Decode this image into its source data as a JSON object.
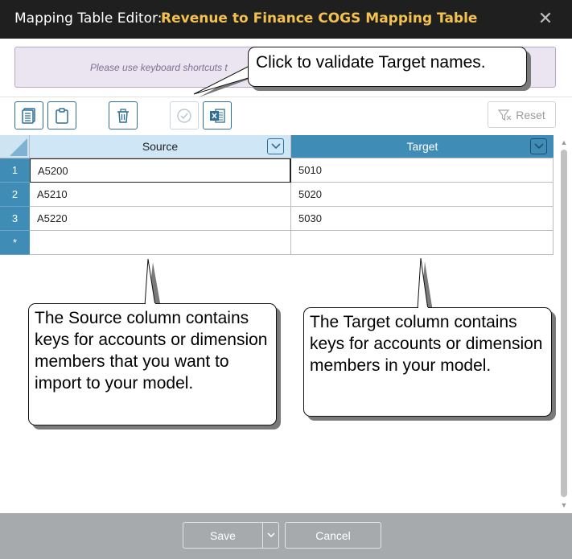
{
  "title_bar": {
    "label": "Mapping Table Editor:",
    "table_name": "Revenue to Finance COGS Mapping Table",
    "close_glyph": "✕"
  },
  "banner": {
    "text": "Please use keyboard shortcuts t"
  },
  "toolbar": {
    "buttons": [
      {
        "name": "copy-rows-icon",
        "enabled": true
      },
      {
        "name": "paste-icon",
        "enabled": true
      },
      {
        "name": "delete-icon",
        "enabled": true
      },
      {
        "name": "validate-icon",
        "enabled": false
      },
      {
        "name": "excel-export-icon",
        "enabled": true
      }
    ],
    "reset_label": "Reset"
  },
  "grid": {
    "columns": [
      "Source",
      "Target"
    ],
    "rows": [
      {
        "num": "1",
        "source": "A5200",
        "target": "5010"
      },
      {
        "num": "2",
        "source": "A5210",
        "target": "5020"
      },
      {
        "num": "3",
        "source": "A5220",
        "target": "5030"
      }
    ],
    "new_row_marker": "*"
  },
  "footer": {
    "save_label": "Save",
    "cancel_label": "Cancel"
  },
  "callouts": {
    "top": "Click to validate Target names.",
    "source": "The Source column contains keys for accounts or dimension members that you want to import to your model.",
    "target": "The Target column contains keys for accounts or dimension members in your model."
  },
  "colors": {
    "title_bg": "#1f1f1f",
    "title_accent": "#f2c14e",
    "grid_accent": "#3f8cb7",
    "banner_bg": "#ebe5f2",
    "footer_bg": "#a7aaad"
  }
}
